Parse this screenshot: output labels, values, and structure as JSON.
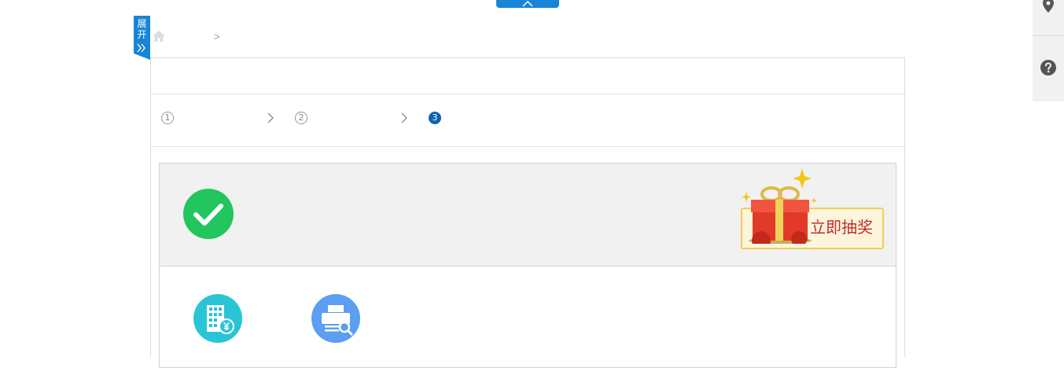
{
  "top_toggle": {
    "icon": "chevron-up-icon",
    "color": "#1a85d6"
  },
  "expand_ribbon": {
    "label_line1": "展",
    "label_line2": "开",
    "icon": "double-chevron-right-icon",
    "color": "#1a85d6"
  },
  "breadcrumb": {
    "home_icon": "home-icon",
    "separator": ">"
  },
  "steps": [
    {
      "number": "1",
      "state": "done"
    },
    {
      "number": "2",
      "state": "done"
    },
    {
      "number": "3",
      "state": "current"
    }
  ],
  "result": {
    "status_icon": "check-circle-icon",
    "status_color": "#22c55e"
  },
  "lottery": {
    "label": "立即抽奖",
    "icon": "gift-box-icon"
  },
  "actions": [
    {
      "icon": "building-yen-icon",
      "color": "#29c4d6"
    },
    {
      "icon": "printer-search-icon",
      "color": "#5b9ef2"
    }
  ],
  "side_tools": [
    {
      "icon": "location-pin-icon"
    },
    {
      "icon": "help-question-icon"
    }
  ]
}
